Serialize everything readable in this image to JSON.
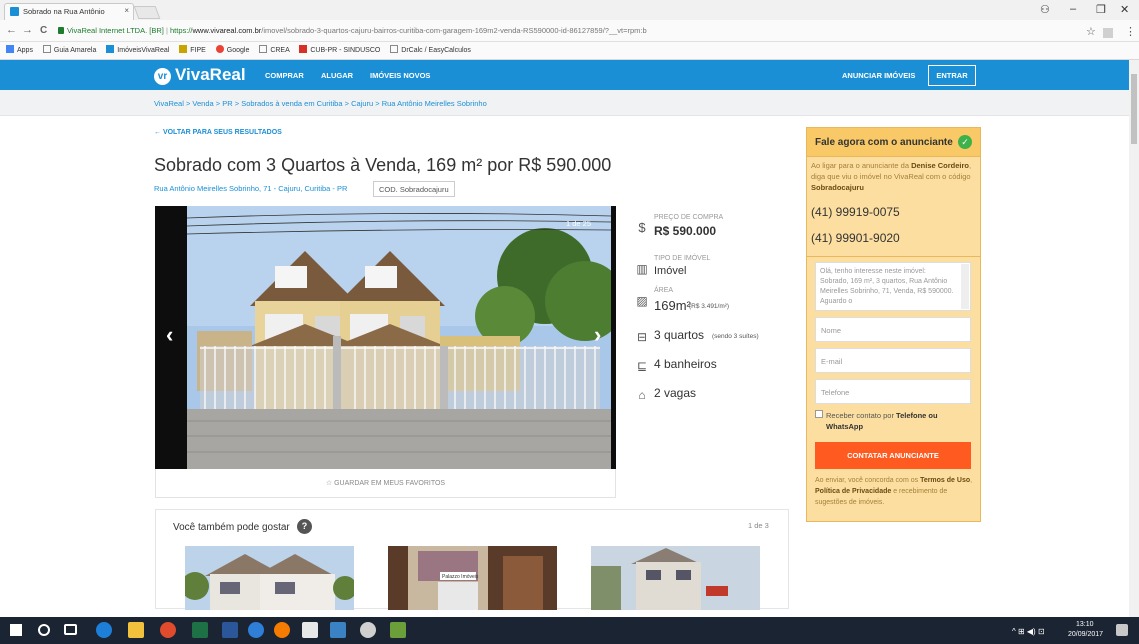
{
  "browser": {
    "tab_title": "Sobrado na Rua Antônio",
    "tab_close": "×",
    "url_site": "VivaReal Internet LTDA. [BR]",
    "url_sep": " | ",
    "url_https": "https://",
    "url_host": "www.vivareal.com.br",
    "url_path": "/imovel/sobrado-3-quartos-cajuru-bairros-curitiba-com-garagem-169m2-venda-RS590000-id-86127859/?__vt=rpm:b",
    "back": "←",
    "forward": "→",
    "reload": "C",
    "star": "☆",
    "menu": "⋮",
    "profile": "⚇",
    "minimize": "–",
    "maximize": "❐",
    "close": "✕",
    "bookmarks": [
      "Apps",
      "Guia Amarela",
      "ImóveisVivaReal",
      "FIPE",
      "Google",
      "CREA",
      "CUB-PR - SINDUSCO",
      "DrCalc / EasyCalculos"
    ]
  },
  "header": {
    "logo": "VivaReal",
    "logo_mark": "vr",
    "nav": [
      "COMPRAR",
      "ALUGAR",
      "IMÓVEIS NOVOS"
    ],
    "anunciar": "ANUNCIAR IMÓVEIS",
    "entrar": "ENTRAR"
  },
  "breadcrumb": "VivaReal > Venda > PR > Sobrados à venda em Curitiba > Cajuru > Rua Antônio Meirelles Sobrinho",
  "listing": {
    "back_link": "← VOLTAR PARA SEUS RESULTADOS",
    "title": "Sobrado com 3 Quartos à Venda, 169 m² por R$ 590.000",
    "address": "Rua Antônio Meirelles Sobrinho, 71 - Cajuru, Curitiba - PR",
    "code": "COD. Sobradocajuru",
    "photo_counter": "1 de 25",
    "prev_arrow": "‹",
    "next_arrow": "›",
    "favorite": "☆  GUARDAR EM MEUS FAVORITOS"
  },
  "specs": {
    "price_label": "PREÇO DE COMPRA",
    "price": "R$ 590.000",
    "type_label": "TIPO DE IMÓVEL",
    "type": "Imóvel",
    "area_label": "ÁREA",
    "area": "169m²",
    "area_note": "(R$ 3.491/m²)",
    "rooms": "3 quartos",
    "rooms_note": "(sendo 3 suítes)",
    "baths": "4 banheiros",
    "parking": "2 vagas",
    "icons": {
      "price": "$",
      "type": "▥",
      "area": "▨",
      "rooms": "⊟",
      "baths": "⊑",
      "parking": "⌂"
    }
  },
  "contact": {
    "title": "Fale agora com o anunciante",
    "check": "✓",
    "intro_1": "Ao ligar para o anunciante da ",
    "intro_name": "Denise Cordeiro",
    "intro_2": ", diga que viu o imóvel no VivaReal com o código ",
    "intro_code": "Sobradocajuru",
    "phone_1": "(41) 99919-0075",
    "phone_2": "(41) 99901-9020",
    "message": "Olá, tenho interesse neste imóvel: Sobrado, 169 m², 3 quartos, Rua Antônio Meirelles Sobrinho, 71, Venda, R$ 590000. Aguardo o",
    "name_placeholder": "Nome",
    "email_placeholder": "E-mail",
    "phone_placeholder": "Telefone",
    "checkbox_1": "Receber contato por ",
    "checkbox_bold": "Telefone ou WhatsApp",
    "cta": "CONTATAR ANUNCIANTE",
    "terms_1": "Ao enviar, você concorda com os ",
    "terms_bold_1": "Termos de Uso",
    "terms_2": ", ",
    "terms_bold_2": "Política de Privacidade",
    "terms_3": " e recebimento de sugestões de imóveis."
  },
  "recommendations": {
    "title": "Você também pode gostar",
    "help": "?",
    "count": "1 de 3",
    "sign_text": "Palazzo Imóveis"
  },
  "taskbar": {
    "time": "13:10",
    "date": "20/09/2017",
    "tray": "^ ⊞ ◀) ⊡"
  }
}
